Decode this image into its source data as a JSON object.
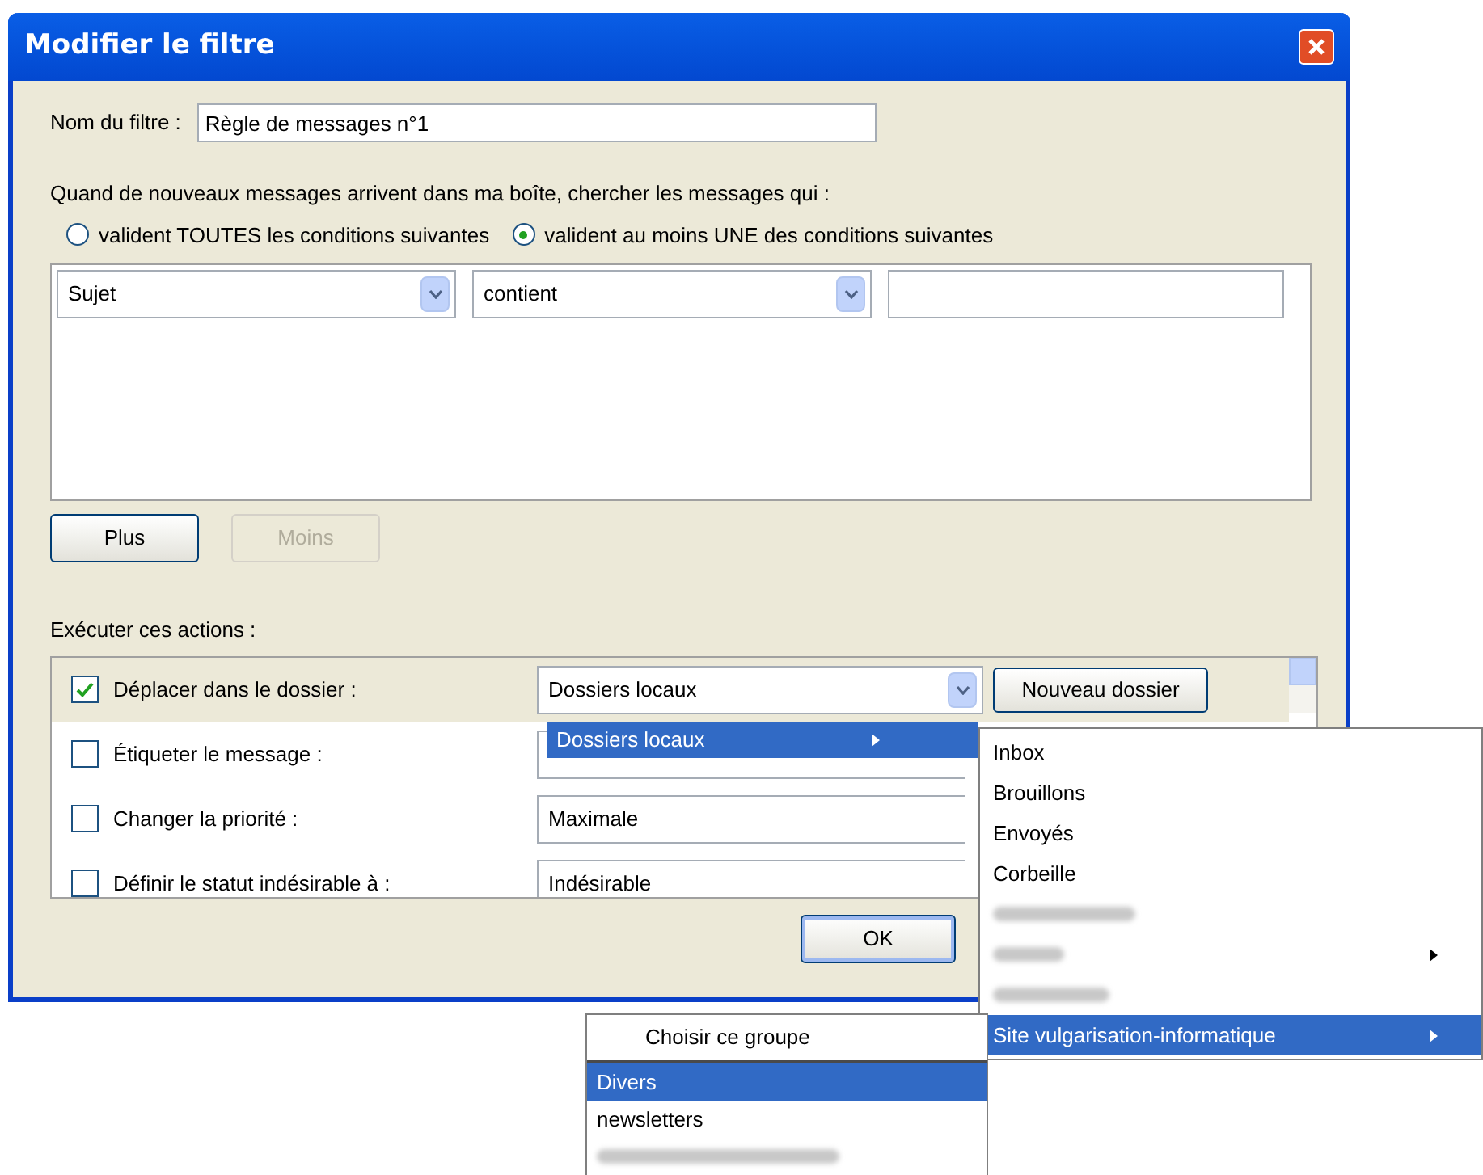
{
  "window": {
    "title": "Modifier le filtre"
  },
  "filter_name": {
    "label": "Nom du filtre :",
    "value": "Règle de messages n°1"
  },
  "match": {
    "prompt": "Quand de nouveaux messages arrivent dans ma boîte, chercher les messages qui :",
    "options": [
      {
        "label": "valident TOUTES les conditions suivantes",
        "selected": false
      },
      {
        "label": "valident au moins UNE des conditions suivantes",
        "selected": true
      }
    ]
  },
  "conditions": [
    {
      "field": "Sujet",
      "operator": "contient"
    }
  ],
  "condition_buttons": [
    {
      "label": "Plus",
      "disabled": false
    },
    {
      "label": "Moins",
      "disabled": true
    }
  ],
  "actions_label": "Exécuter ces actions :",
  "actions": [
    {
      "label": "Déplacer dans le dossier :",
      "checked": true,
      "selected": true,
      "value": "Dossiers locaux"
    },
    {
      "label": "Étiqueter le message :",
      "checked": false,
      "selected": false
    },
    {
      "label": "Changer la priorité :",
      "checked": false,
      "selected": false,
      "value": "Maximale"
    },
    {
      "label": "Définir le statut indésirable à :",
      "checked": false,
      "selected": false,
      "value": "Indésirable"
    }
  ],
  "new_folder_button": "Nouveau dossier",
  "ok_button": "OK",
  "folder_menu": {
    "items": [
      {
        "label": "Dossiers locaux",
        "selected": true,
        "submenu": true
      }
    ]
  },
  "submenu": {
    "items": [
      {
        "kind": "text",
        "label": "Inbox",
        "selected": false,
        "submenu": false
      },
      {
        "kind": "text",
        "label": "Brouillons",
        "selected": false,
        "submenu": false
      },
      {
        "kind": "text",
        "label": "Envoyés",
        "selected": false,
        "submenu": false
      },
      {
        "kind": "text",
        "label": "Corbeille",
        "selected": false,
        "submenu": false
      },
      {
        "kind": "blurred",
        "selected": false,
        "submenu": false
      },
      {
        "kind": "blurred",
        "selected": false,
        "submenu": true
      },
      {
        "kind": "blurred",
        "selected": false,
        "submenu": false
      },
      {
        "kind": "text",
        "label": "Site vulgarisation-informatique",
        "selected": true,
        "submenu": true
      }
    ]
  },
  "group_menu": {
    "choose": "Choisir ce groupe",
    "items": [
      {
        "kind": "text",
        "label": "Divers",
        "selected": true
      },
      {
        "kind": "text",
        "label": "newsletters",
        "selected": false
      },
      {
        "kind": "blurred",
        "selected": false
      }
    ]
  }
}
